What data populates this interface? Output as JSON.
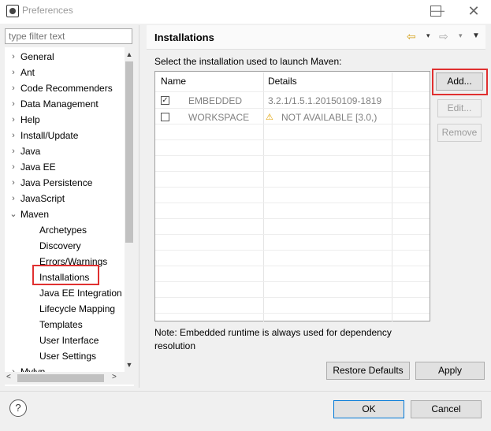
{
  "window": {
    "title": "Preferences",
    "minimize": "—",
    "close": "✕"
  },
  "filter": {
    "placeholder": "type filter text"
  },
  "tree": {
    "items": [
      {
        "label": "General",
        "arrow": "›"
      },
      {
        "label": "Ant",
        "arrow": "›"
      },
      {
        "label": "Code Recommenders",
        "arrow": "›"
      },
      {
        "label": "Data Management",
        "arrow": "›"
      },
      {
        "label": "Help",
        "arrow": "›"
      },
      {
        "label": "Install/Update",
        "arrow": "›"
      },
      {
        "label": "Java",
        "arrow": "›"
      },
      {
        "label": "Java EE",
        "arrow": "›"
      },
      {
        "label": "Java Persistence",
        "arrow": "›"
      },
      {
        "label": "JavaScript",
        "arrow": "›"
      },
      {
        "label": "Maven",
        "arrow": "⌄"
      },
      {
        "label": "Archetypes"
      },
      {
        "label": "Discovery"
      },
      {
        "label": "Errors/Warnings"
      },
      {
        "label": "Installations"
      },
      {
        "label": "Java EE Integration"
      },
      {
        "label": "Lifecycle Mapping"
      },
      {
        "label": "Templates"
      },
      {
        "label": "User Interface"
      },
      {
        "label": "User Settings"
      },
      {
        "label": "Mylyn",
        "arrow": "›"
      }
    ]
  },
  "page": {
    "title": "Installations",
    "instruction": "Select the installation used to launch Maven:",
    "columns": {
      "name": "Name",
      "details": "Details"
    },
    "rows": [
      {
        "checked": true,
        "check_glyph": "✓",
        "name": "EMBEDDED",
        "details": "3.2.1/1.5.1.20150109-1819"
      },
      {
        "checked": false,
        "check_glyph": "",
        "name": "WORKSPACE",
        "warning_icon": "⚠",
        "details": "NOT AVAILABLE [3.0,)"
      }
    ],
    "note": "Note: Embedded runtime is always used for dependency resolution",
    "buttons": {
      "add": "Add...",
      "edit": "Edit...",
      "remove": "Remove",
      "restore": "Restore Defaults",
      "apply": "Apply"
    },
    "nav": {
      "back": "⇦",
      "forward": "⇨",
      "dropdown": "▾",
      "menu": "▼"
    }
  },
  "footer": {
    "help": "?",
    "ok": "OK",
    "cancel": "Cancel"
  },
  "scroll": {
    "up": "▲",
    "down": "▼",
    "left": "<",
    "right": ">"
  },
  "colors": {
    "highlight_border": "#e03030",
    "warning": "#e0a000",
    "back_arrow": "#d4a017"
  }
}
